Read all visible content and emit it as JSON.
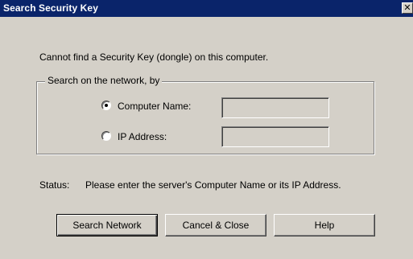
{
  "window": {
    "title": "Search Security Key",
    "close_glyph": "✕"
  },
  "message": "Cannot find a Security Key (dongle) on this computer.",
  "search_group": {
    "label": "Search on the network, by",
    "options": [
      {
        "label": "Computer Name:",
        "selected": true,
        "value": ""
      },
      {
        "label": "IP Address:",
        "selected": false,
        "value": ""
      }
    ]
  },
  "status": {
    "label": "Status:",
    "text": "Please enter the server's Computer Name or its IP Address."
  },
  "buttons": {
    "search": "Search Network",
    "cancel": "Cancel & Close",
    "help": "Help"
  },
  "colors": {
    "titlebar": "#0a246a",
    "face": "#d4d0c8"
  },
  "icons": {
    "close": "close-icon",
    "radio_selected": "radio-selected-icon",
    "radio_unselected": "radio-unselected-icon"
  }
}
